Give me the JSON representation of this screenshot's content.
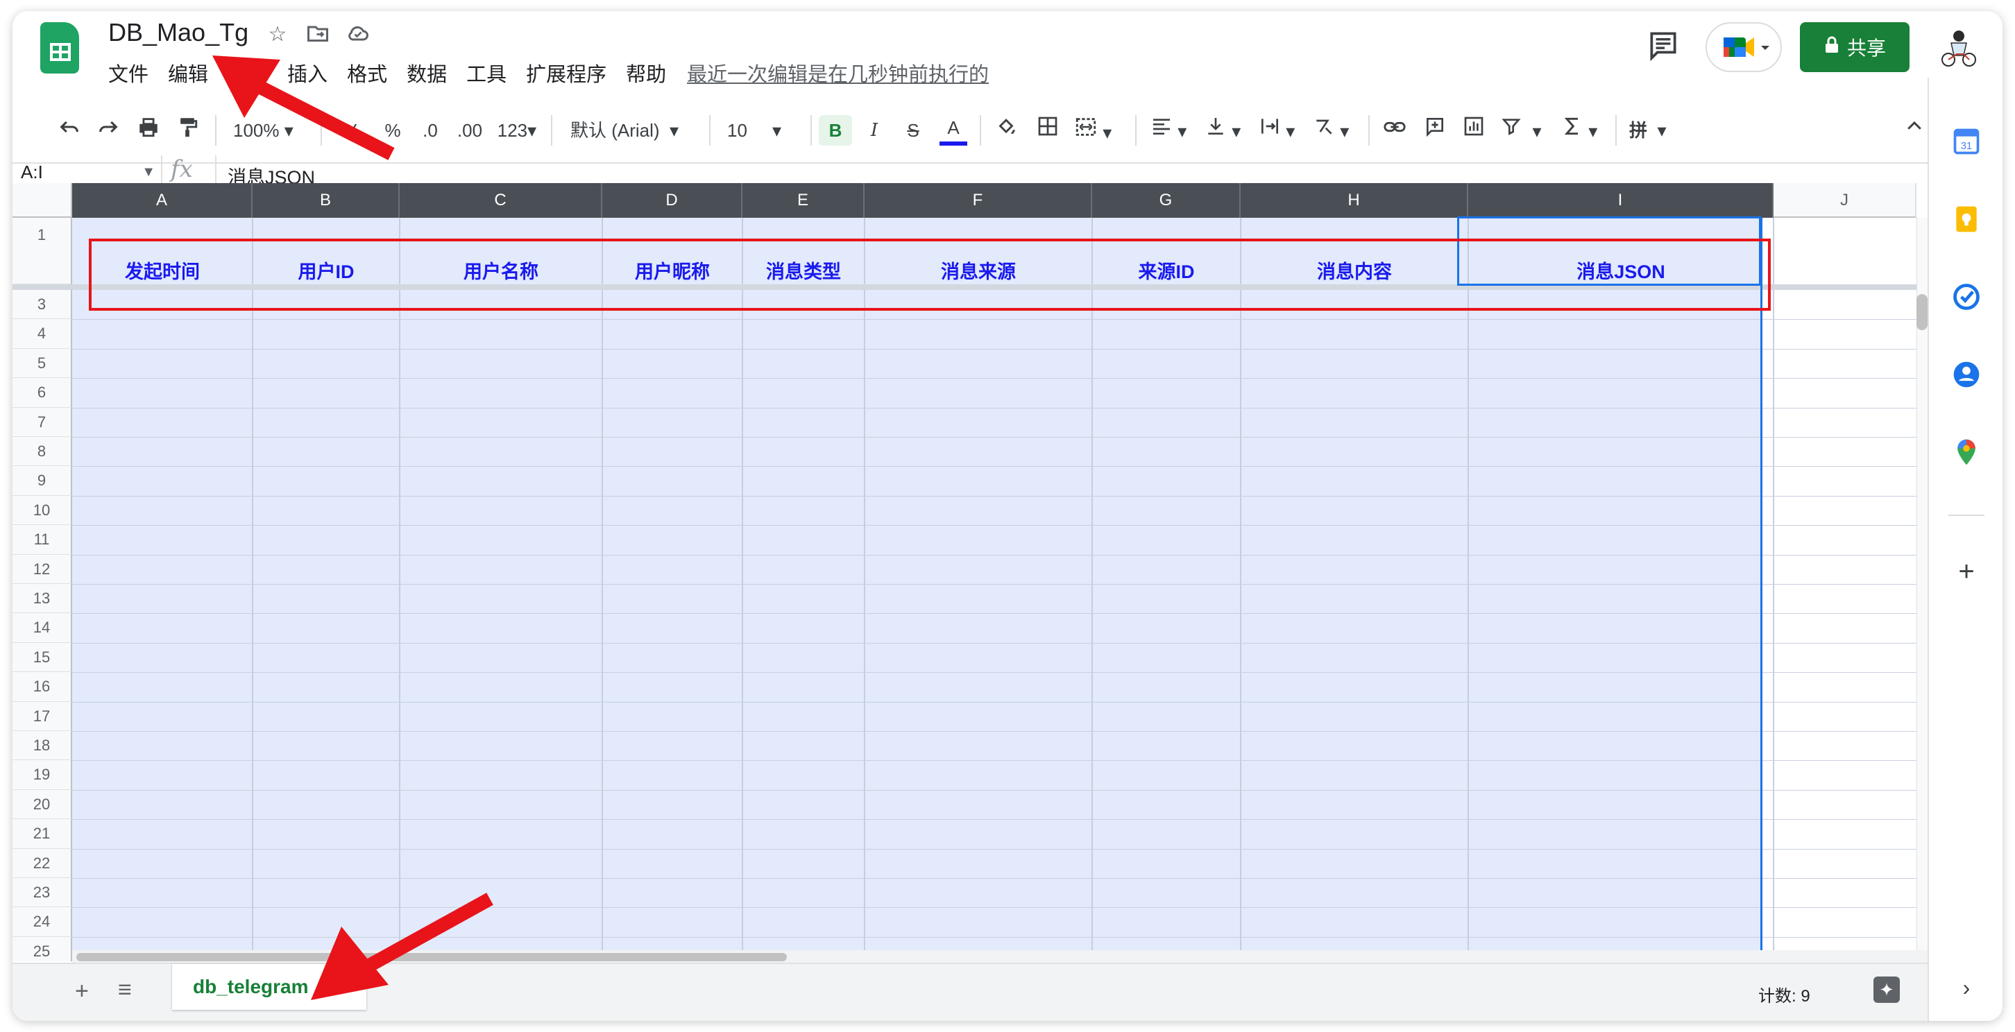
{
  "document": {
    "title": "DB_Mao_Tg",
    "last_edit": "最近一次编辑是在几秒钟前执行的"
  },
  "menu": [
    "文件",
    "编辑",
    "查看",
    "插入",
    "格式",
    "数据",
    "工具",
    "扩展程序",
    "帮助"
  ],
  "header": {
    "share_label": "共享"
  },
  "toolbar": {
    "zoom": "100%",
    "currency": "¥",
    "percent": "%",
    "dec_decrease": ".0",
    "dec_increase": ".00",
    "number_format": "123",
    "font": "默认 (Arial)",
    "font_size": "10",
    "bold": "B",
    "italic": "I",
    "strike": "S",
    "text_color": "A",
    "input_tools": "拼"
  },
  "formula_bar": {
    "name_box": "A:I",
    "fx": "fx",
    "value": "消息JSON"
  },
  "grid": {
    "columns": [
      "A",
      "B",
      "C",
      "D",
      "E",
      "F",
      "G",
      "H",
      "I",
      "J"
    ],
    "row_numbers": [
      "1",
      "3",
      "4",
      "5",
      "6",
      "7",
      "8",
      "9",
      "10",
      "11",
      "12",
      "13",
      "14",
      "15",
      "16",
      "17",
      "18",
      "19",
      "20",
      "21",
      "22",
      "23",
      "24",
      "25"
    ],
    "header_row": [
      "发起时间",
      "用户ID",
      "用户名称",
      "用户昵称",
      "消息类型",
      "消息来源",
      "来源ID",
      "消息内容",
      "消息JSON"
    ]
  },
  "sheet_tabs": [
    {
      "label": "db_telegram"
    }
  ],
  "status": {
    "count": "计数: 9"
  },
  "colors": {
    "accent_green": "#188038",
    "selection_blue": "#e2eafb",
    "header_text": "#1a1aee",
    "annotation_red": "#e8141a"
  }
}
